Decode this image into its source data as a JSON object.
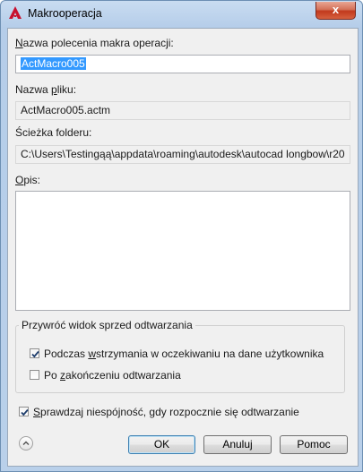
{
  "window": {
    "title": "Makrooperacja",
    "close_glyph": "x"
  },
  "command_name": {
    "label_pre": "",
    "label_key": "N",
    "label_post": "azwa polecenia makra operacji:",
    "value": "ActMacro005"
  },
  "file_name": {
    "label_pre": "Nazwa ",
    "label_key": "p",
    "label_post": "liku:",
    "value": "ActMacro005.actm"
  },
  "folder_path": {
    "label": "Ścieżka folderu:",
    "value": "C:\\Users\\Testingąą\\appdata\\roaming\\autodesk\\autocad longbow\\r20"
  },
  "description": {
    "label_pre": "",
    "label_key": "O",
    "label_post": "pis:",
    "value": ""
  },
  "restore_view": {
    "group_title": "Przywróć widok sprzed odtwarzania",
    "option1_pre": "Podczas ",
    "option1_key": "w",
    "option1_post": "strzymania w oczekiwaniu na dane użytkownika",
    "option1_checked": true,
    "option2_pre": "Po ",
    "option2_key": "z",
    "option2_post": "akończeniu odtwarzania",
    "option2_checked": false
  },
  "check_inconsistency": {
    "pre": "",
    "key": "S",
    "post": "prawdzaj niespójność, gdy rozpocznie się odtwarzanie",
    "checked": true
  },
  "buttons": {
    "ok": "OK",
    "cancel": "Anuluj",
    "help": "Pomoc"
  },
  "colors": {
    "accent": "#3399ff",
    "close": "#c2391d",
    "app_icon": "#c8102e"
  },
  "icons": {
    "app": "autocad-logo-icon",
    "close": "close-icon",
    "expand": "chevron-up-icon"
  }
}
